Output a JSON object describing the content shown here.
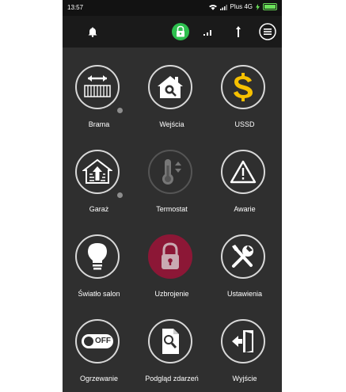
{
  "status_bar": {
    "time": "13:57",
    "carrier": "Plus 4G"
  },
  "top_bar": {
    "icons": [
      "bell-icon",
      "lock-icon",
      "signal-icon",
      "antenna-icon",
      "menu-icon"
    ],
    "lock_color": "#2dbf4e"
  },
  "tiles": [
    {
      "label": "Brama",
      "icon": "gate-icon"
    },
    {
      "label": "Wejścia",
      "icon": "house-search-icon"
    },
    {
      "label": "USSD",
      "icon": "dollar-icon"
    },
    {
      "label": "Garaż",
      "icon": "garage-icon"
    },
    {
      "label": "Termostat",
      "icon": "thermometer-icon"
    },
    {
      "label": "Awarie",
      "icon": "warning-icon"
    },
    {
      "label": "Światło salon",
      "icon": "bulb-icon"
    },
    {
      "label": "Uzbrojenie",
      "icon": "padlock-icon"
    },
    {
      "label": "Ustawienia",
      "icon": "tools-icon"
    },
    {
      "label": "Ogrzewanie",
      "icon": "toggle-icon"
    },
    {
      "label": "Podgląd zdarzeń",
      "icon": "document-search-icon"
    },
    {
      "label": "Wyjście",
      "icon": "exit-door-icon"
    }
  ],
  "toggle_text": "OFF",
  "colors": {
    "accent_armed": "#8c1736",
    "dollar": "#f6c000",
    "phone_bg": "#2f2f2f"
  }
}
